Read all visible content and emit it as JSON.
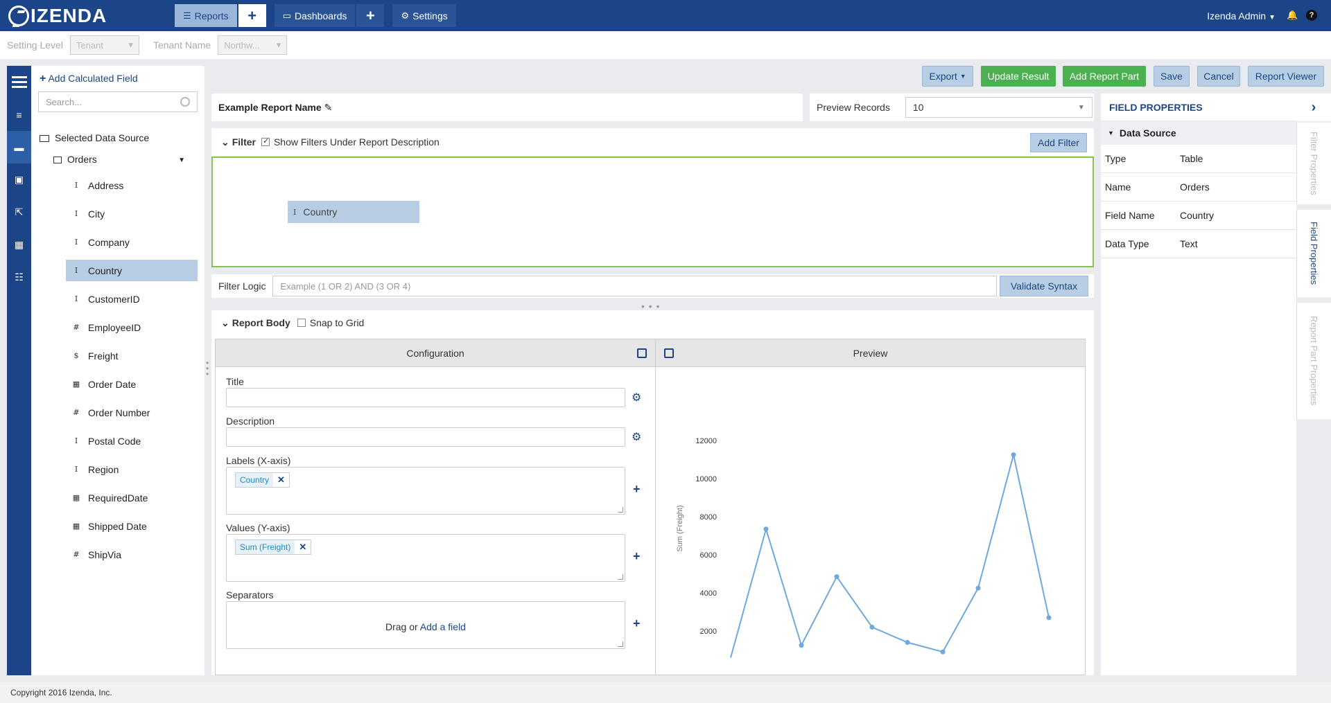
{
  "brand": "IZENDA",
  "nav": {
    "tabs": [
      {
        "label": "Reports"
      },
      {
        "label": "Dashboards"
      },
      {
        "label": "Settings"
      }
    ],
    "user": "Izenda Admin"
  },
  "settings_bar": {
    "setting_level_label": "Setting Level",
    "setting_level_value": "Tenant",
    "tenant_name_label": "Tenant Name",
    "tenant_name_value": "Northw..."
  },
  "field_panel": {
    "add_calculated": "Add Calculated Field",
    "search_placeholder": "Search...",
    "data_source_title": "Selected Data Source",
    "table_name": "Orders",
    "fields": [
      {
        "type": "I",
        "name": "Address"
      },
      {
        "type": "I",
        "name": "City"
      },
      {
        "type": "I",
        "name": "Company"
      },
      {
        "type": "I",
        "name": "Country"
      },
      {
        "type": "I",
        "name": "CustomerID"
      },
      {
        "type": "#",
        "name": "EmployeeID"
      },
      {
        "type": "$",
        "name": "Freight"
      },
      {
        "type": "▦",
        "name": "Order Date"
      },
      {
        "type": "#",
        "name": "Order Number"
      },
      {
        "type": "I",
        "name": "Postal Code"
      },
      {
        "type": "I",
        "name": "Region"
      },
      {
        "type": "▦",
        "name": "RequiredDate"
      },
      {
        "type": "▦",
        "name": "Shipped Date"
      },
      {
        "type": "#",
        "name": "ShipVia"
      }
    ]
  },
  "toolbar": {
    "export": "Export",
    "update_result": "Update Result",
    "add_report_part": "Add Report Part",
    "save": "Save",
    "cancel": "Cancel",
    "report_viewer": "Report Viewer"
  },
  "report": {
    "name": "Example Report Name",
    "preview_records_label": "Preview Records",
    "preview_records_value": "10"
  },
  "filter": {
    "title": "Filter",
    "show_filters_label": "Show Filters Under Report Description",
    "add_filter": "Add Filter",
    "chip": "Country",
    "logic_label": "Filter Logic",
    "logic_placeholder": "Example (1 OR 2) AND (3 OR 4)",
    "validate": "Validate Syntax"
  },
  "report_body": {
    "title": "Report Body",
    "snap_to_grid": "Snap to Grid",
    "config_header": "Configuration",
    "preview_header": "Preview",
    "title_label": "Title",
    "description_label": "Description",
    "labels_label": "Labels (X-axis)",
    "labels_tag": "Country",
    "values_label": "Values (Y-axis)",
    "values_tag": "Sum (Freight)",
    "separators_label": "Separators",
    "drag_or": "Drag or",
    "add_field": "Add a field"
  },
  "field_properties": {
    "title": "FIELD PROPERTIES",
    "section": "Data Source",
    "rows": [
      {
        "key": "Type",
        "value": "Table"
      },
      {
        "key": "Name",
        "value": "Orders"
      },
      {
        "key": "Field Name",
        "value": "Country"
      },
      {
        "key": "Data Type",
        "value": "Text"
      }
    ],
    "vertical_tabs": [
      "Filter Properties",
      "Field Properties",
      "Report Part Properties"
    ]
  },
  "chart_data": {
    "type": "line",
    "ylabel": "Sum (Freight)",
    "yticks": [
      2000,
      4000,
      6000,
      8000,
      10000,
      12000
    ],
    "ylim": [
      0,
      13000
    ],
    "values": [
      600,
      7350,
      1250,
      4850,
      2200,
      1400,
      900,
      4250,
      11250,
      2700
    ],
    "color": "#6fa8dc"
  },
  "footer": "Copyright 2016 Izenda, Inc."
}
